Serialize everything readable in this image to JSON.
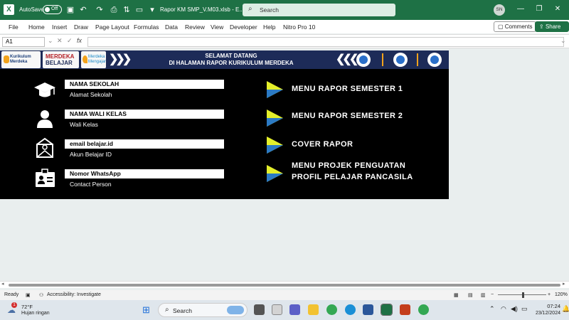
{
  "titlebar": {
    "autosave_label": "AutoSave",
    "autosave_state": "Off",
    "filename": "Rapor KM SMP_V.M03.xlsb  -  E...",
    "search_placeholder": "Search",
    "user_initials": "SN"
  },
  "menu": {
    "items": [
      "File",
      "Home",
      "Insert",
      "Draw",
      "Page Layout",
      "Formulas",
      "Data",
      "Review",
      "View",
      "Developer",
      "Help",
      "Nitro Pro 10"
    ],
    "comments_label": "Comments",
    "share_label": "Share"
  },
  "formula_bar": {
    "name_box": "A1",
    "fx_label": "fx",
    "value": ""
  },
  "banner": {
    "logo1_line1": "Kurikulum",
    "logo1_line2": "Merdeka",
    "logo2_line1": "MERDEKA",
    "logo2_line2": "BELAJAR",
    "logo3_line1": "Merdeka",
    "logo3_line2": "Mengajar",
    "title_line1": "SELAMAT DATANG",
    "title_line2": "DI HALAMAN RAPOR KURIKULUM MERDEKA"
  },
  "info": [
    {
      "icon": "graduation-cap-icon",
      "label": "NAMA SEKOLAH",
      "sub": "Alamat Sekolah"
    },
    {
      "icon": "person-icon",
      "label": "NAMA WALI KELAS",
      "sub": "Wali Kelas"
    },
    {
      "icon": "email-icon",
      "label": "email belajar.id",
      "sub": "Akun Belajar ID"
    },
    {
      "icon": "contact-card-icon",
      "label": "Nomor WhatsApp",
      "sub": "Contact Person"
    }
  ],
  "menus": {
    "semester1": "MENU RAPOR SEMESTER 1",
    "semester2": "MENU RAPOR SEMESTER 2",
    "cover": "COVER RAPOR",
    "projek_line1": "MENU PROJEK PENGUATAN",
    "projek_line2": "PROFIL PELAJAR PANCASILA"
  },
  "status": {
    "ready": "Ready",
    "accessibility": "Accessibility: Investigate",
    "zoom": "120%"
  },
  "taskbar": {
    "temperature": "72°F",
    "weather": "Hujan ringan",
    "weather_badge": "1",
    "search_placeholder": "Search",
    "time": "07:24",
    "date": "23/12/2024"
  },
  "colors": {
    "excel_green": "#1e7145",
    "banner_navy": "#1d2b58",
    "arrow_yellow": "#e4ef2a",
    "accent_orange": "#f2a21c"
  }
}
